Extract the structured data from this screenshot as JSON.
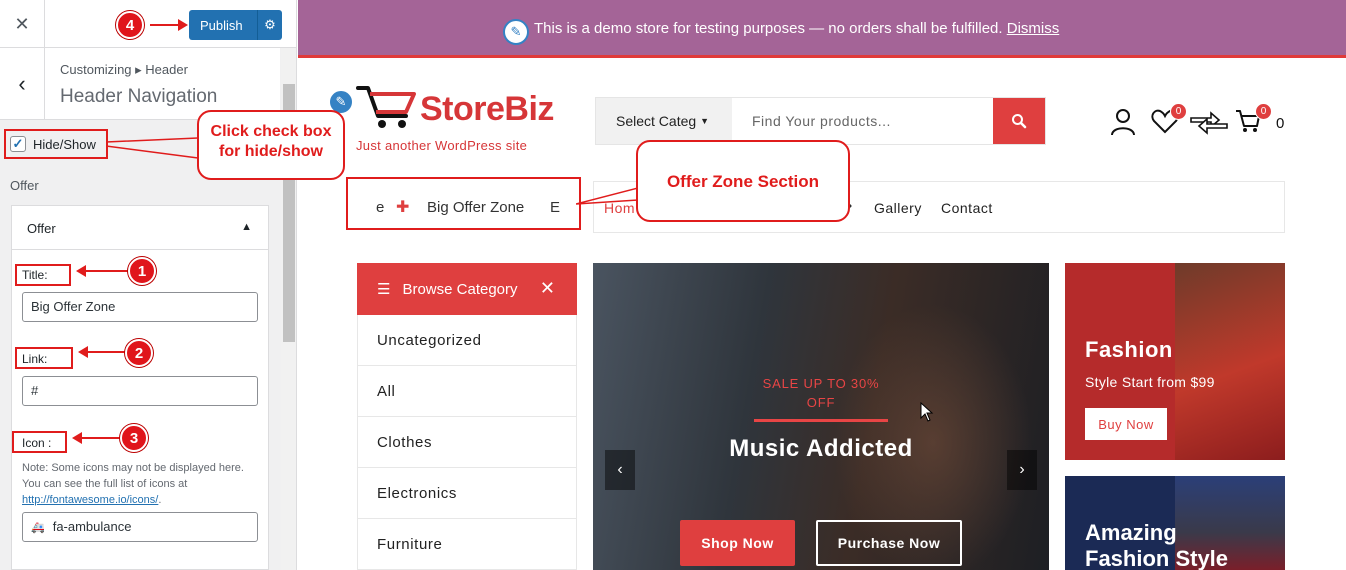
{
  "customizer": {
    "close_icon": "✕",
    "publish_label": "Publish",
    "breadcrumb": "Customizing ▸ Header",
    "section_title": "Header Navigation",
    "hide_show_label": "Hide/Show",
    "hide_show_checked": true,
    "offer_group_label": "Offer",
    "offer_panel_title": "Offer",
    "fields": {
      "title_label": "Title:",
      "title_value": "Big Offer Zone",
      "link_label": "Link:",
      "link_value": "#",
      "icon_label": "Icon :",
      "icon_note_1": "Note: Some icons may not be displayed here. You can see the full list of icons at ",
      "icon_note_link": "http://fontawesome.io/icons/",
      "icon_note_end": ".",
      "icon_value": "fa-ambulance"
    }
  },
  "annotations": {
    "step1": "1",
    "step2": "2",
    "step3": "3",
    "step4": "4",
    "checkbox_callout": "Click check box for hide/show",
    "offer_callout": "Offer Zone Section"
  },
  "store": {
    "notice_text": "This is a demo store for testing purposes — no orders shall be fulfilled.",
    "notice_dismiss": "Dismiss",
    "logo_text": "StoreBiz",
    "tagline": "Just another WordPress site",
    "search_category": "Select Categ",
    "search_placeholder": "Find Your products...",
    "wishlist_count": "0",
    "cart_count": "0",
    "cart_total": "0",
    "offer_zone": {
      "prefix": "e",
      "text": "Big Offer Zone",
      "suffix": "E"
    },
    "nav_items": [
      "Hom",
      "Gallery",
      "Contact"
    ],
    "browse_label": "Browse Category",
    "categories": [
      "Uncategorized",
      "All",
      "Clothes",
      "Electronics",
      "Furniture"
    ],
    "hero": {
      "sale": "SALE UP TO 30% OFF",
      "heading": "Music Addicted",
      "shop_now": "Shop Now",
      "purchase_now": "Purchase Now"
    },
    "promo1": {
      "title": "Fashion",
      "subtitle": "Style Start from $99",
      "button": "Buy Now"
    },
    "promo2": {
      "title": "Amazing Fashion Style"
    }
  },
  "colors": {
    "accent_red": "#df3f3f",
    "wp_blue": "#2271b1",
    "notice_purple": "#a46497"
  }
}
